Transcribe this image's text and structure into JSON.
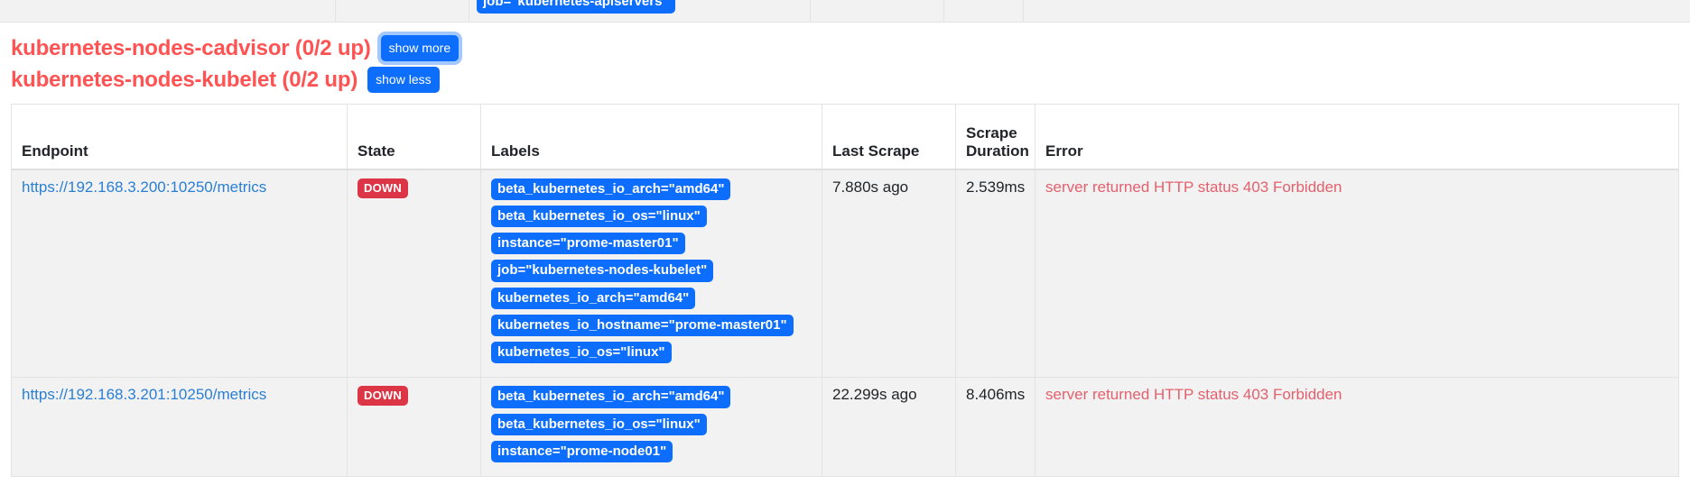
{
  "top_partial_row": {
    "label_badge": "job=\"kubernetes-apiservers\""
  },
  "jobs": [
    {
      "title": "kubernetes-nodes-cadvisor (0/2 up)",
      "toggle_label": "show more",
      "focused": true
    },
    {
      "title": "kubernetes-nodes-kubelet (0/2 up)",
      "toggle_label": "show less",
      "focused": false
    }
  ],
  "table": {
    "columns": [
      "Endpoint",
      "State",
      "Labels",
      "Last Scrape",
      "Scrape Duration",
      "Error"
    ],
    "rows": [
      {
        "endpoint": "https://192.168.3.200:10250/metrics",
        "state": "DOWN",
        "labels": [
          "beta_kubernetes_io_arch=\"amd64\"",
          "beta_kubernetes_io_os=\"linux\"",
          "instance=\"prome-master01\"",
          "job=\"kubernetes-nodes-kubelet\"",
          "kubernetes_io_arch=\"amd64\"",
          "kubernetes_io_hostname=\"prome-master01\"",
          "kubernetes_io_os=\"linux\""
        ],
        "last_scrape": "7.880s ago",
        "scrape_duration": "2.539ms",
        "error": "server returned HTTP status 403 Forbidden"
      },
      {
        "endpoint": "https://192.168.3.201:10250/metrics",
        "state": "DOWN",
        "labels": [
          "beta_kubernetes_io_arch=\"amd64\"",
          "beta_kubernetes_io_os=\"linux\"",
          "instance=\"prome-node01\""
        ],
        "last_scrape": "22.299s ago",
        "scrape_duration": "8.406ms",
        "error": "server returned HTTP status 403 Forbidden"
      }
    ]
  },
  "colors": {
    "badge_blue": "#0d6efd",
    "state_down_red": "#dc3545",
    "job_title_red": "#ff5252",
    "link_blue": "#2a7fd4",
    "error_red": "#e4606d",
    "row_bg": "#f2f2f2"
  }
}
